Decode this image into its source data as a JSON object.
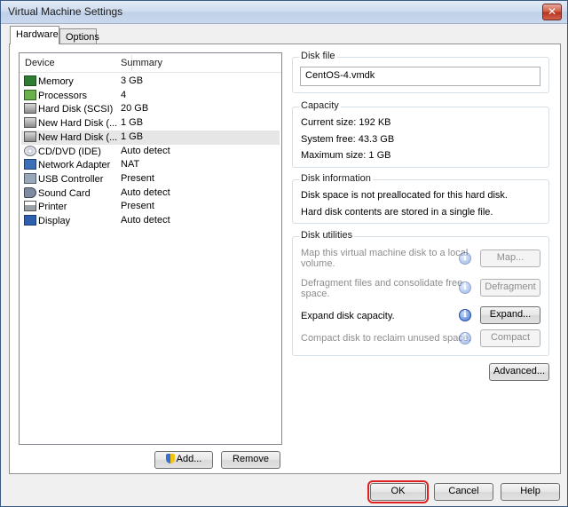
{
  "window": {
    "title": "Virtual Machine Settings",
    "close_glyph": "✕"
  },
  "tabs": [
    {
      "label": "Hardware",
      "active": true
    },
    {
      "label": "Options",
      "active": false
    }
  ],
  "device_list": {
    "columns": [
      "Device",
      "Summary"
    ],
    "rows": [
      {
        "device": "Memory",
        "summary": "3 GB",
        "icon": "memory-icon",
        "selected": false
      },
      {
        "device": "Processors",
        "summary": "4",
        "icon": "processor-icon",
        "selected": false
      },
      {
        "device": "Hard Disk (SCSI)",
        "summary": "20 GB",
        "icon": "hard-disk-icon",
        "selected": false
      },
      {
        "device": "New Hard Disk (...",
        "summary": "1 GB",
        "icon": "hard-disk-icon",
        "selected": false
      },
      {
        "device": "New Hard Disk (...",
        "summary": "1 GB",
        "icon": "hard-disk-icon",
        "selected": true
      },
      {
        "device": "CD/DVD (IDE)",
        "summary": "Auto detect",
        "icon": "cd-dvd-icon",
        "selected": false
      },
      {
        "device": "Network Adapter",
        "summary": "NAT",
        "icon": "network-adapter-icon",
        "selected": false
      },
      {
        "device": "USB Controller",
        "summary": "Present",
        "icon": "usb-icon",
        "selected": false
      },
      {
        "device": "Sound Card",
        "summary": "Auto detect",
        "icon": "speaker-icon",
        "selected": false
      },
      {
        "device": "Printer",
        "summary": "Present",
        "icon": "printer-icon",
        "selected": false
      },
      {
        "device": "Display",
        "summary": "Auto detect",
        "icon": "display-icon",
        "selected": false
      }
    ],
    "add_label": "Add...",
    "remove_label": "Remove"
  },
  "disk_file": {
    "label": "Disk file",
    "value": "CentOS-4.vmdk"
  },
  "capacity": {
    "label": "Capacity",
    "current_size": "Current size:  192 KB",
    "system_free": "System free:  43.3 GB",
    "maximum_size": "Maximum size:  1 GB"
  },
  "disk_information": {
    "label": "Disk information",
    "line1": "Disk space is not preallocated for this hard disk.",
    "line2": "Hard disk contents are stored in a single file."
  },
  "disk_utilities": {
    "label": "Disk utilities",
    "map_text_1": "Map this virtual machine disk to a local",
    "map_text_2": "volume.",
    "map_button": "Map...",
    "defrag_text_1": "Defragment files and consolidate free",
    "defrag_text_2": "space.",
    "defrag_button": "Defragment",
    "expand_text": "Expand disk capacity.",
    "expand_button": "Expand...",
    "compact_text": "Compact disk to reclaim unused space.",
    "compact_button": "Compact",
    "info_glyph": "i"
  },
  "advanced_button": "Advanced...",
  "footer": {
    "ok": "OK",
    "cancel": "Cancel",
    "help": "Help"
  }
}
